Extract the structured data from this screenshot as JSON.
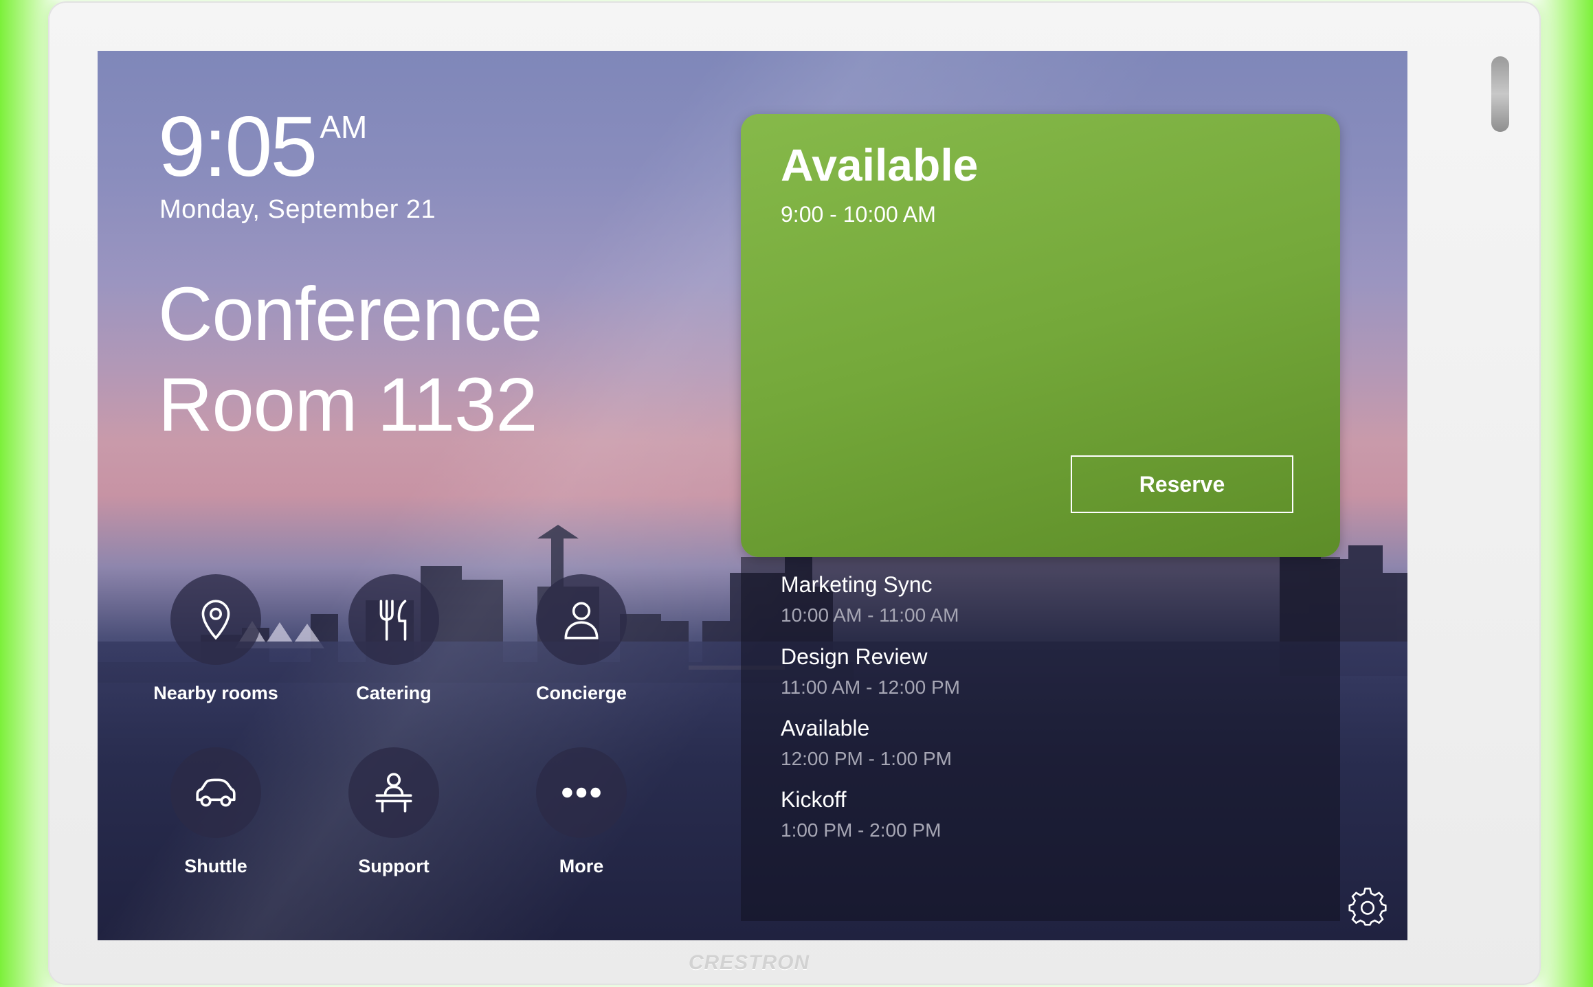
{
  "clock": {
    "time": "9:05",
    "ampm": "AM",
    "date": "Monday, September 21"
  },
  "room": {
    "line1": "Conference",
    "line2": "Room 1132"
  },
  "tiles": [
    {
      "label": "Nearby rooms",
      "icon": "location-pin-icon"
    },
    {
      "label": "Catering",
      "icon": "fork-knife-icon"
    },
    {
      "label": "Concierge",
      "icon": "person-icon"
    },
    {
      "label": "Shuttle",
      "icon": "car-icon"
    },
    {
      "label": "Support",
      "icon": "support-desk-icon"
    },
    {
      "label": "More",
      "icon": "more-dots-icon"
    }
  ],
  "status": {
    "title": "Available",
    "time": "9:00 - 10:00 AM",
    "reserve_label": "Reserve",
    "color": "#76aa3c"
  },
  "schedule": [
    {
      "title": "Marketing Sync",
      "time": "10:00 AM - 11:00 AM"
    },
    {
      "title": "Design Review",
      "time": "11:00 AM - 12:00 PM"
    },
    {
      "title": "Available",
      "time": "12:00 PM - 1:00 PM"
    },
    {
      "title": "Kickoff",
      "time": "1:00 PM - 2:00 PM"
    }
  ],
  "settings": {
    "icon": "gear-icon"
  },
  "device": {
    "brand": "CRESTRON",
    "led_color": "#7cf03a"
  }
}
